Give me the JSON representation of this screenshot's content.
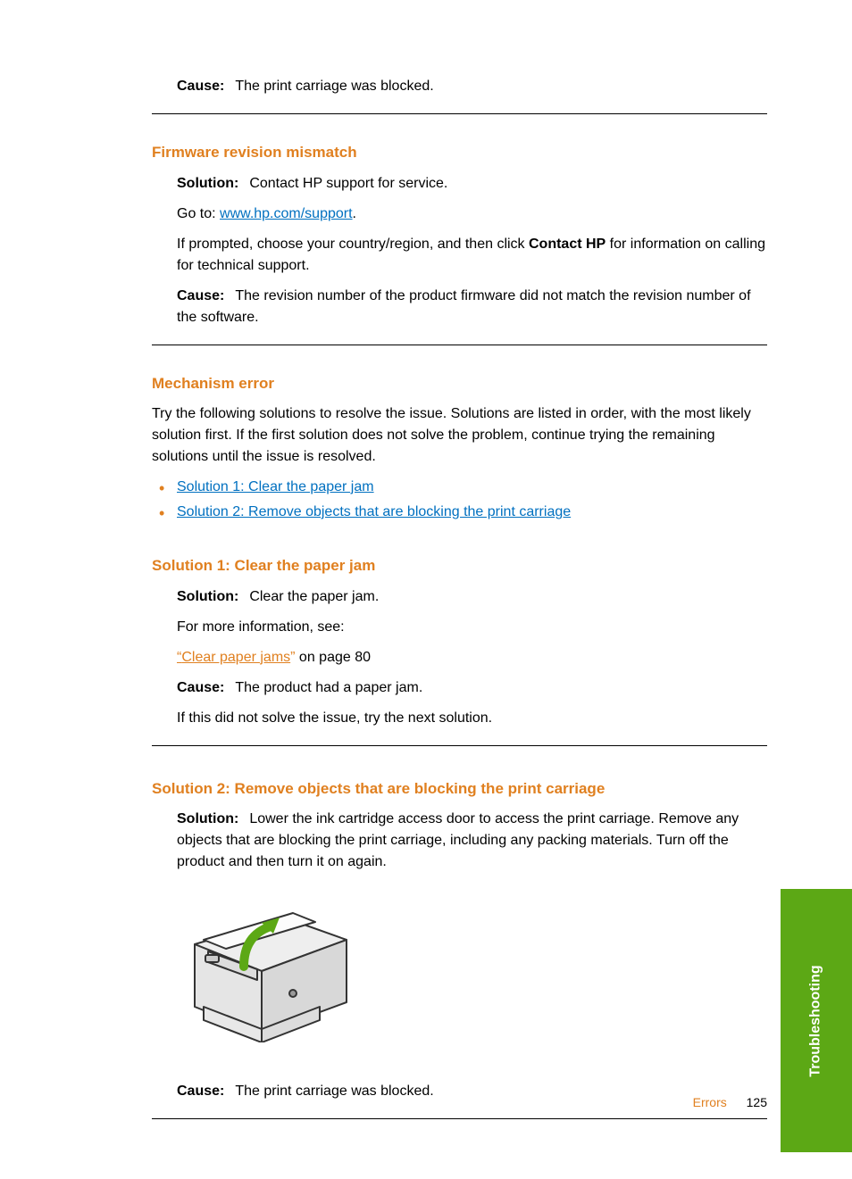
{
  "top_cause": {
    "label": "Cause:",
    "text": "The print carriage was blocked."
  },
  "firmware": {
    "heading": "Firmware revision mismatch",
    "solution_label": "Solution:",
    "solution_text": "Contact HP support for service.",
    "goto_prefix": "Go to: ",
    "goto_link": "www.hp.com/support",
    "goto_suffix": ".",
    "prompt_prefix": "If prompted, choose your country/region, and then click ",
    "prompt_bold": "Contact HP",
    "prompt_suffix": " for information on calling for technical support.",
    "cause_label": "Cause:",
    "cause_text": "The revision number of the product firmware did not match the revision number of the software."
  },
  "mechanism": {
    "heading": "Mechanism error",
    "intro": "Try the following solutions to resolve the issue. Solutions are listed in order, with the most likely solution first. If the first solution does not solve the problem, continue trying the remaining solutions until the issue is resolved.",
    "bullets": [
      "Solution 1: Clear the paper jam",
      "Solution 2: Remove objects that are blocking the print carriage"
    ]
  },
  "solution1": {
    "heading": "Solution 1: Clear the paper jam",
    "solution_label": "Solution:",
    "solution_text": "Clear the paper jam.",
    "more_info": "For more information, see:",
    "link_quote_open": "“",
    "link_text": "Clear paper jams",
    "link_quote_close": "”",
    "link_suffix": " on page 80",
    "cause_label": "Cause:",
    "cause_text": "The product had a paper jam.",
    "next": "If this did not solve the issue, try the next solution."
  },
  "solution2": {
    "heading": "Solution 2: Remove objects that are blocking the print carriage",
    "solution_label": "Solution:",
    "solution_text": "Lower the ink cartridge access door to access the print carriage. Remove any objects that are blocking the print carriage, including any packing materials. Turn off the product and then turn it on again.",
    "cause_label": "Cause:",
    "cause_text": "The print carriage was blocked."
  },
  "side_tab": "Troubleshooting",
  "footer": {
    "section": "Errors",
    "page": "125"
  }
}
